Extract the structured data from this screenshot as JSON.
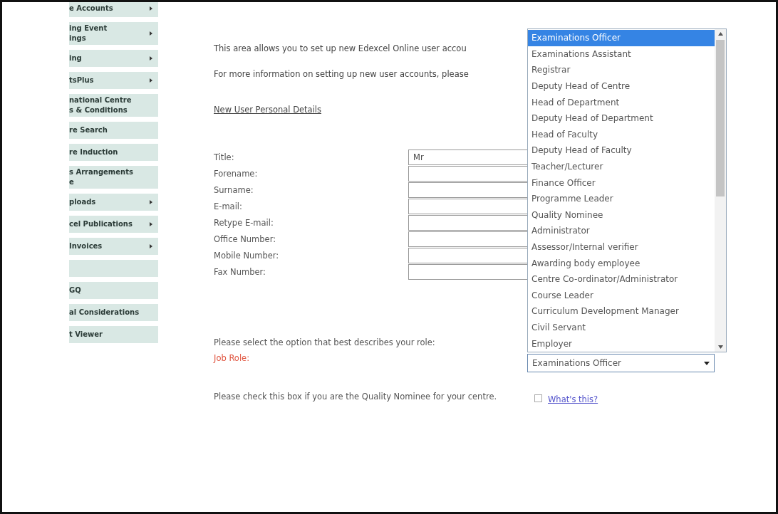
{
  "sidebar": {
    "items": [
      {
        "lines": [
          "e Accounts"
        ],
        "submenu": true
      },
      {
        "lines": [
          "ing Event",
          "ings"
        ],
        "submenu": true
      },
      {
        "lines": [
          "ing"
        ],
        "submenu": true
      },
      {
        "lines": [
          "tsPlus"
        ],
        "submenu": true
      },
      {
        "lines": [
          "national Centre",
          "s & Conditions"
        ],
        "submenu": false
      },
      {
        "lines": [
          "re Search"
        ],
        "submenu": false
      },
      {
        "lines": [
          "re Induction"
        ],
        "submenu": false
      },
      {
        "lines": [
          "s Arrangements",
          "e"
        ],
        "submenu": false
      },
      {
        "lines": [
          "ploads"
        ],
        "submenu": true
      },
      {
        "lines": [
          "cel Publications"
        ],
        "submenu": true
      },
      {
        "lines": [
          "Invoices"
        ],
        "submenu": true
      },
      {
        "submenu": false
      },
      {
        "lines": [
          "GQ"
        ],
        "submenu": false
      },
      {
        "lines": [
          "al Considerations"
        ],
        "submenu": false
      },
      {
        "lines": [
          "t Viewer"
        ],
        "submenu": false
      }
    ]
  },
  "intro": [
    "This area allows you to set up new Edexcel Online user accou",
    "For more information on setting up new user accounts, please"
  ],
  "section_link": "New User Personal Details",
  "form": {
    "fields": [
      {
        "label": "Title:",
        "value": "Mr"
      },
      {
        "label": "Forename:"
      },
      {
        "label": "Surname:"
      },
      {
        "label": "E-mail:"
      },
      {
        "label": "Retype E-mail:"
      },
      {
        "label": "Office Number:"
      },
      {
        "label": "Mobile Number:"
      },
      {
        "label": "Fax Number:"
      }
    ],
    "role_question": "Please select the option that best describes your role:",
    "role_label": "Job Role:",
    "role_select": {
      "value": "Examinations Officer",
      "expanded": true,
      "options": [
        {
          "label": "Examinations Officer",
          "selected": true
        },
        {
          "label": "Examinations Assistant",
          "selected": false
        },
        {
          "label": "Registrar",
          "selected": false
        },
        {
          "label": "Deputy Head of Centre",
          "selected": false
        },
        {
          "label": "Head of Department",
          "selected": false
        },
        {
          "label": "Deputy Head of Department",
          "selected": false
        },
        {
          "label": "Head of Faculty",
          "selected": false
        },
        {
          "label": "Deputy Head of Faculty",
          "selected": false
        },
        {
          "label": "Teacher/Lecturer",
          "selected": false
        },
        {
          "label": "Finance Officer",
          "selected": false
        },
        {
          "label": "Programme Leader",
          "selected": false
        },
        {
          "label": "Quality Nominee",
          "selected": false
        },
        {
          "label": "Administrator",
          "selected": false
        },
        {
          "label": "Assessor/Internal verifier",
          "selected": false
        },
        {
          "label": "Awarding body employee",
          "selected": false
        },
        {
          "label": "Centre Co-ordinator/Administrator",
          "selected": false
        },
        {
          "label": "Course Leader",
          "selected": false
        },
        {
          "label": "Curriculum Development Manager",
          "selected": false
        },
        {
          "label": "Civil Servant",
          "selected": false
        },
        {
          "label": "Employer",
          "selected": false
        }
      ]
    },
    "nominee_question": "Please check this box if you are the Quality Nominee for your centre.",
    "nominee_checked": false,
    "whats_this": "What's this?"
  }
}
